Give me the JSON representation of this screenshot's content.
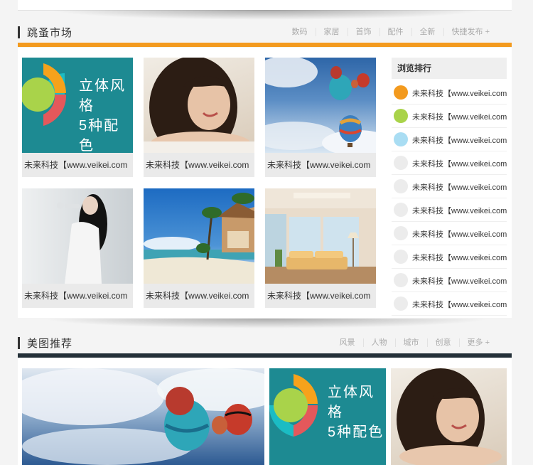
{
  "sections": [
    {
      "title": "跳蚤市场",
      "nav": [
        "数码",
        "家居",
        "首饰",
        "配件",
        "全新",
        "快捷发布 +"
      ],
      "accent": "#f39a1e"
    },
    {
      "title": "美图推荐",
      "nav": [
        "风景",
        "人物",
        "城市",
        "创意",
        "更多 +"
      ],
      "accent": "#243038"
    }
  ],
  "grid": [
    {
      "art": "cover",
      "caption": "未来科技【www.veikei.com"
    },
    {
      "art": "woman",
      "caption": "未来科技【www.veikei.com"
    },
    {
      "art": "balloons",
      "caption": "未来科技【www.veikei.com"
    },
    {
      "art": "model",
      "caption": "未来科技【www.veikei.com"
    },
    {
      "art": "beach",
      "caption": "未来科技【www.veikei.com"
    },
    {
      "art": "room",
      "caption": "未来科技【www.veikei.com"
    }
  ],
  "cover_art": {
    "line1": "立体风格",
    "line2": "5种配色"
  },
  "ranking": {
    "title": "浏览排行",
    "items": [
      {
        "label": "未来科技【www.veikei.com",
        "color": "#f39a1e"
      },
      {
        "label": "未来科技【www.veikei.com",
        "color": "#a9d34a"
      },
      {
        "label": "未来科技【www.veikei.com",
        "color": "#a9ddf3"
      },
      {
        "label": "未来科技【www.veikei.com",
        "color": "#ececec"
      },
      {
        "label": "未来科技【www.veikei.com",
        "color": "#ececec"
      },
      {
        "label": "未来科技【www.veikei.com",
        "color": "#ececec"
      },
      {
        "label": "未来科技【www.veikei.com",
        "color": "#ececec"
      },
      {
        "label": "未来科技【www.veikei.com",
        "color": "#ececec"
      },
      {
        "label": "未来科技【www.veikei.com",
        "color": "#ececec"
      },
      {
        "label": "未来科技【www.veikei.com",
        "color": "#ececec"
      }
    ]
  },
  "bottom_cover_art": {
    "line1": "立体风格",
    "line2": "5种配色"
  }
}
